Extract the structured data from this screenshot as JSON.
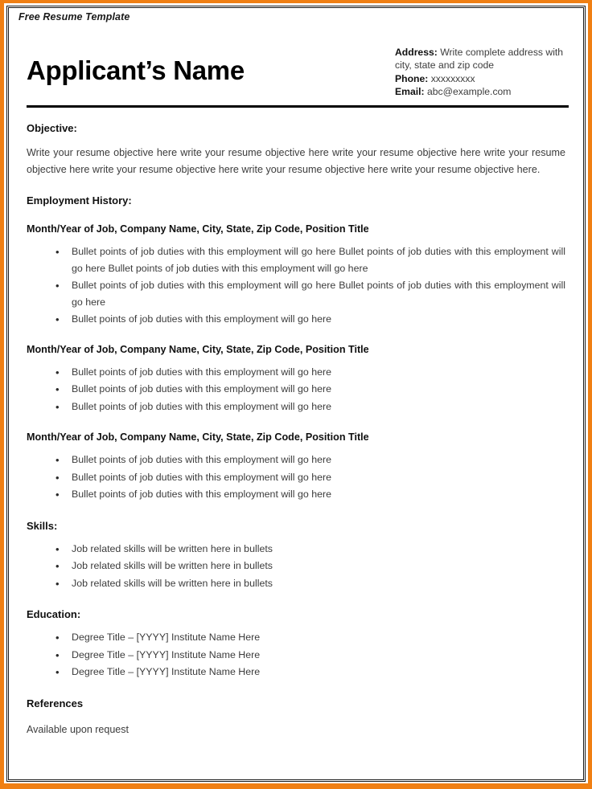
{
  "document": {
    "template_label": "Free Resume Template",
    "applicant_name": "Applicant’s Name"
  },
  "colors": {
    "outer_border": "#F07F13",
    "inner_border": "#1a1a1a",
    "heading_text": "#111111",
    "body_text": "#3c3c3c",
    "rule": "#000000"
  },
  "contact": {
    "address_label": "Address:",
    "address_value": " Write complete address with city, state and zip code",
    "phone_label": "Phone:",
    "phone_value": " xxxxxxxxx",
    "email_label": "Email:",
    "email_value": " abc@example.com"
  },
  "sections": {
    "objective": {
      "heading": "Objective:",
      "body": "Write your resume objective here write your resume objective here write your resume objective here write your resume objective here write your resume objective here write your resume objective here write your resume objective here."
    },
    "employment": {
      "heading": "Employment History:",
      "jobs": [
        {
          "title_line": "Month/Year of Job, Company Name, City, State, Zip Code, Position Title",
          "bullets": [
            "Bullet points of job duties with this employment will go here Bullet points of job duties with this employment will go here Bullet points of job duties with this employment will go here",
            "Bullet points of job duties with this employment will go here Bullet points of job duties with this employment will go here",
            "Bullet points of job duties with this employment will go here"
          ]
        },
        {
          "title_line": "Month/Year of Job, Company Name, City, State, Zip Code, Position Title",
          "bullets": [
            "Bullet points of job duties with this employment will go here",
            "Bullet points of job duties with this employment will go here",
            "Bullet points of job duties with this employment will go here"
          ]
        },
        {
          "title_line": "Month/Year of Job, Company Name, City, State, Zip Code, Position Title",
          "bullets": [
            "Bullet points of job duties with this employment will go here",
            "Bullet points of job duties with this employment will go here",
            "Bullet points of job duties with this employment will go here"
          ]
        }
      ]
    },
    "skills": {
      "heading": "Skills:",
      "bullets": [
        "Job related skills will be written here in bullets",
        "Job related skills will be written here in bullets",
        "Job related skills will be written here in bullets"
      ]
    },
    "education": {
      "heading": "Education:",
      "bullets": [
        "Degree Title – [YYYY] Institute Name Here",
        "Degree Title – [YYYY] Institute Name Here",
        "Degree Title – [YYYY] Institute Name Here"
      ]
    },
    "references": {
      "heading": "References",
      "body": "Available upon request"
    }
  }
}
